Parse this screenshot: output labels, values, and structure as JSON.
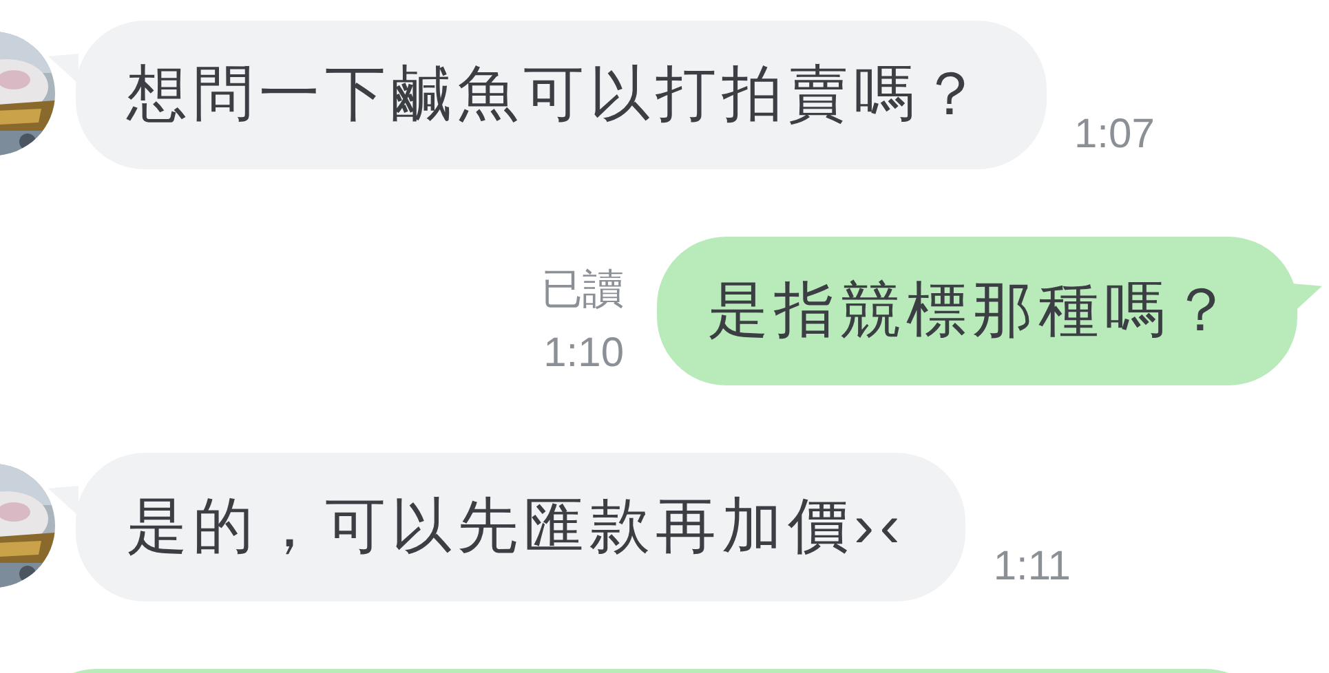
{
  "messages": [
    {
      "kind": "incoming",
      "text": "想問一下鹹魚可以打拍賣嗎？",
      "time": "1:07"
    },
    {
      "kind": "outgoing",
      "status": "已讀",
      "text": "是指競標那種嗎？",
      "time": "1:10"
    },
    {
      "kind": "incoming",
      "text": "是的，可以先匯款再加價›‹",
      "time": "1:11"
    },
    {
      "kind": "outgoing"
    }
  ]
}
